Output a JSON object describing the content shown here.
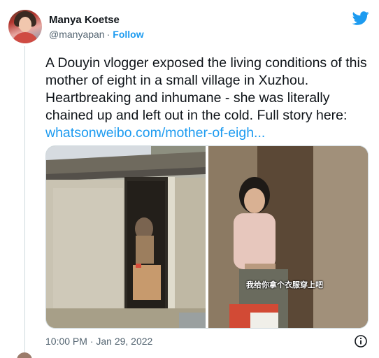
{
  "author": {
    "display_name": "Manya Koetse",
    "handle": "@manyapan",
    "separator": "·",
    "follow_label": "Follow"
  },
  "brand": {
    "icon": "twitter-bird-icon",
    "color": "#1d9bf0"
  },
  "tweet": {
    "text": "A Douyin vlogger exposed the living conditions of this mother of eight in a small village in Xuzhou. Heartbreaking and inhumane - she was literally chained up and left out in the cold. Full story here:",
    "link": "whatsonweibo.com/mother-of-eigh..."
  },
  "media": {
    "right_image_caption": "我给你拿个衣服穿上吧"
  },
  "footer": {
    "timestamp": "10:00 PM · Jan 29, 2022",
    "info_icon": "info-icon"
  },
  "colors": {
    "text": "#0f1419",
    "secondary": "#536471",
    "accent": "#1d9bf0"
  }
}
